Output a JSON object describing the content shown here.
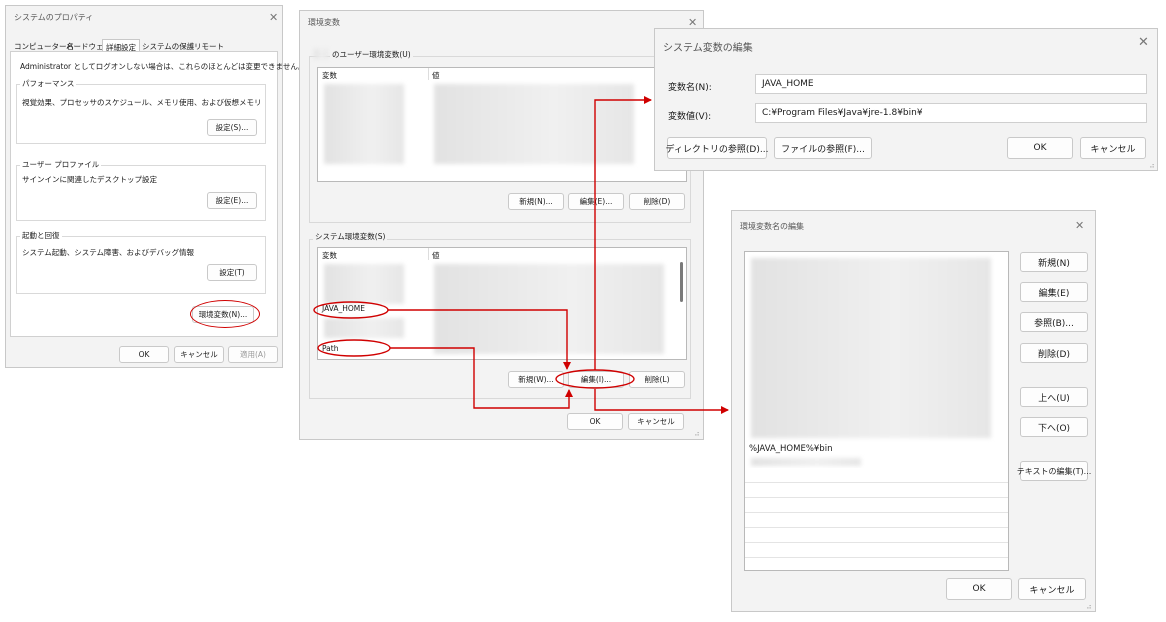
{
  "sysprops": {
    "title": "システムのプロパティ",
    "tabs": [
      "コンピューター名",
      "ハードウェア",
      "詳細設定",
      "システムの保護",
      "リモート"
    ],
    "admin_note": "Administrator としてログオンしない場合は、これらのほとんどは変更できません。",
    "perf_label": "パフォーマンス",
    "perf_desc": "視覚効果、プロセッサのスケジュール、メモリ使用、および仮想メモリ",
    "perf_btn": "設定(S)...",
    "profile_label": "ユーザー プロファイル",
    "profile_desc": "サインインに関連したデスクトップ設定",
    "profile_btn": "設定(E)...",
    "startup_label": "起動と回復",
    "startup_desc": "システム起動、システム障害、およびデバッグ情報",
    "startup_btn": "設定(T)",
    "envvars_btn": "環境変数(N)...",
    "ok": "OK",
    "cancel": "キャンセル",
    "apply": "適用(A)"
  },
  "envvars": {
    "title": "環境変数",
    "user_group": "のユーザー環境変数(U)",
    "col_var": "変数",
    "col_val": "値",
    "user_new": "新規(N)...",
    "user_edit": "編集(E)...",
    "user_delete": "削除(D)",
    "sys_group": "システム環境変数(S)",
    "sys_row_java": "JAVA_HOME",
    "sys_row_path": "Path",
    "sys_new": "新規(W)...",
    "sys_edit": "編集(I)...",
    "sys_delete": "削除(L)",
    "ok": "OK",
    "cancel": "キャンセル"
  },
  "editvar": {
    "title": "システム変数の編集",
    "name_label": "変数名(N):",
    "name_value": "JAVA_HOME",
    "value_label": "変数値(V):",
    "value_value": "C:¥Program Files¥Java¥jre-1.8¥bin¥",
    "browse_dir": "ディレクトリの参照(D)...",
    "browse_file": "ファイルの参照(F)...",
    "ok": "OK",
    "cancel": "キャンセル"
  },
  "editname": {
    "title": "環境変数名の編集",
    "entry": "%JAVA_HOME%¥bin",
    "new": "新規(N)",
    "edit": "編集(E)",
    "browse": "参照(B)...",
    "delete": "削除(D)",
    "up": "上へ(U)",
    "down": "下へ(O)",
    "text_edit": "テキストの編集(T)...",
    "ok": "OK",
    "cancel": "キャンセル"
  },
  "annotation_color": "#d00000"
}
